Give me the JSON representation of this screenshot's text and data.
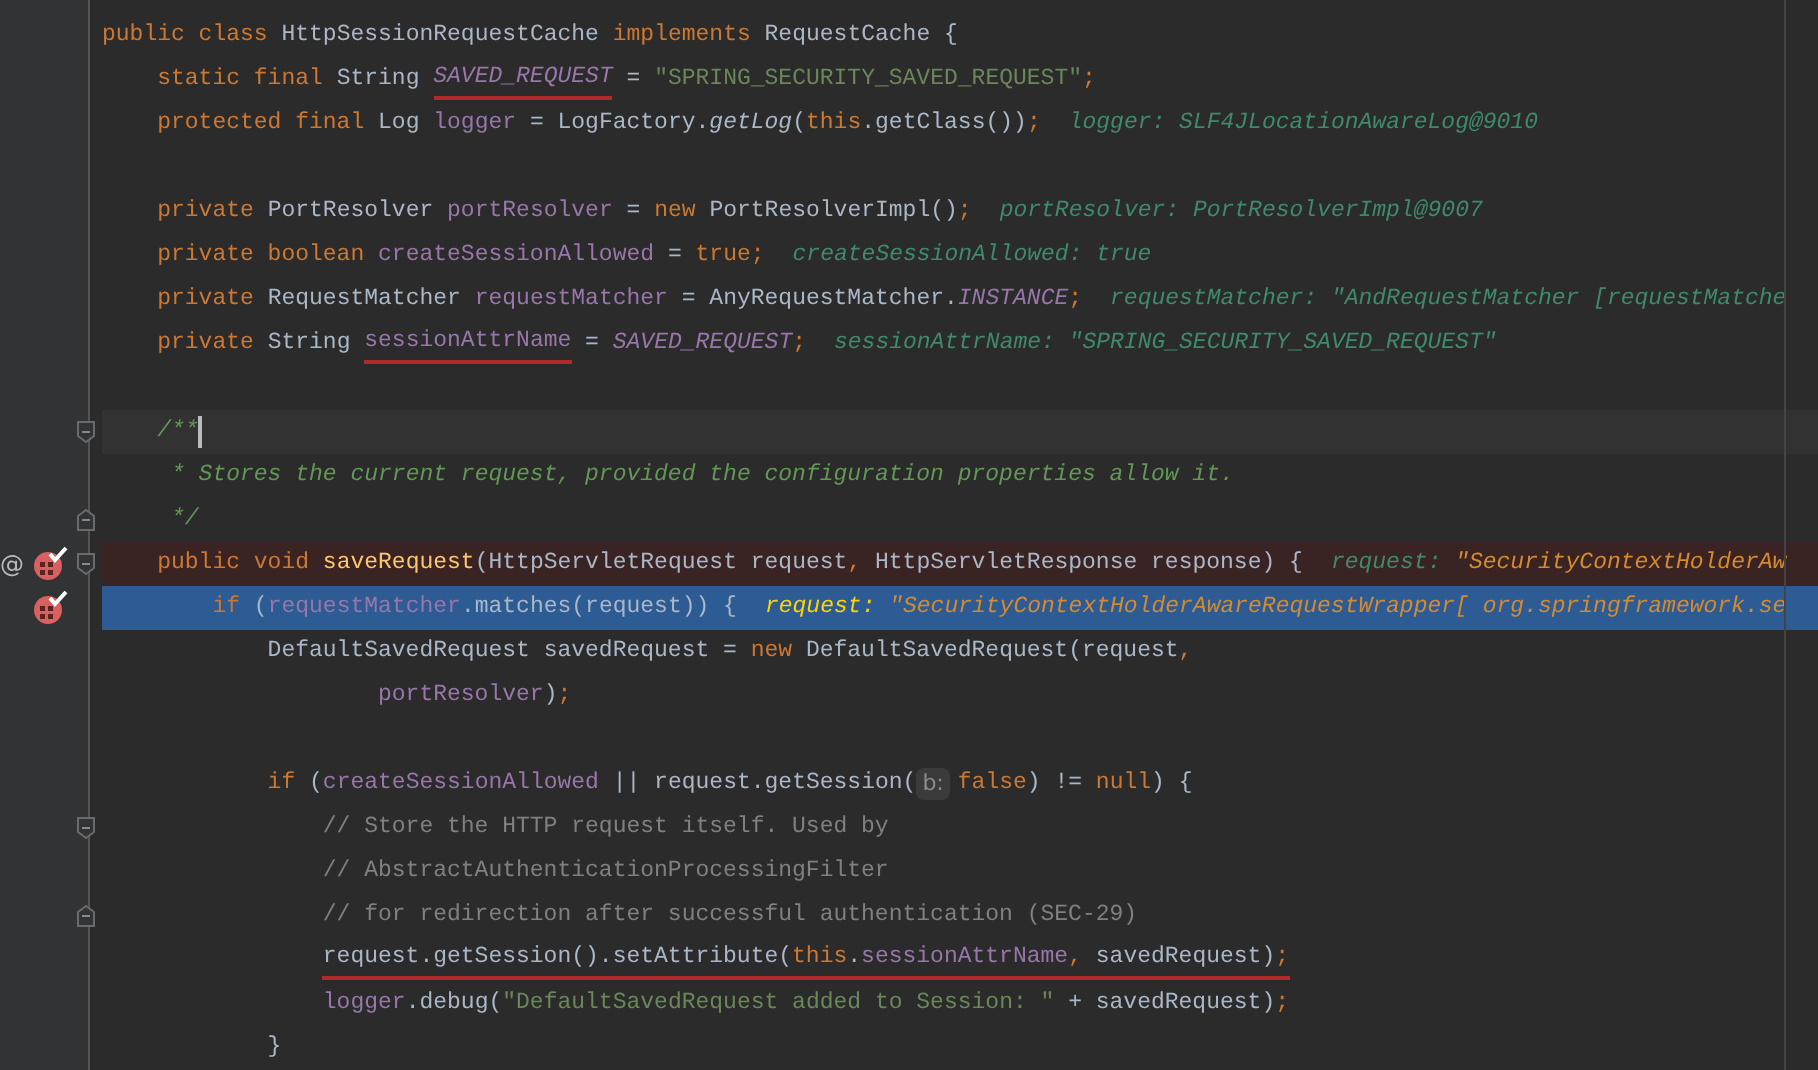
{
  "editor": {
    "lines": [
      {
        "breakpoint": false,
        "execution_point": false,
        "caret": false,
        "tokens": [
          {
            "text": "public class ",
            "kind": "keyword"
          },
          {
            "text": "HttpSessionRequestCache ",
            "kind": "plain"
          },
          {
            "text": "implements ",
            "kind": "keyword"
          },
          {
            "text": "RequestCache {",
            "kind": "plain"
          }
        ],
        "children": [
          {
            "breakpoint": false,
            "execution_point": false,
            "caret": false,
            "tokens": [
              {
                "text": "static final ",
                "kind": "keyword"
              },
              {
                "text": "String ",
                "kind": "plain"
              },
              {
                "text": "SAVED_REQUEST",
                "kind": "static",
                "underlined": true
              },
              {
                "text": " = ",
                "kind": "plain"
              },
              {
                "text": "\"SPRING_SECURITY_SAVED_REQUEST\"",
                "kind": "string"
              },
              {
                "text": ";",
                "kind": "punct"
              }
            ]
          },
          {
            "breakpoint": false,
            "execution_point": false,
            "caret": false,
            "tokens": [
              {
                "text": "protected final ",
                "kind": "keyword"
              },
              {
                "text": "Log ",
                "kind": "plain"
              },
              {
                "text": "logger",
                "kind": "field"
              },
              {
                "text": " = LogFactory.",
                "kind": "plain"
              },
              {
                "text": "getLog",
                "kind": "static_call"
              },
              {
                "text": "(",
                "kind": "plain"
              },
              {
                "text": "this",
                "kind": "keyword"
              },
              {
                "text": ".getClass())",
                "kind": "plain"
              },
              {
                "text": ";",
                "kind": "punct"
              },
              {
                "text": "logger: SLF4JLocationAwareLog@9010",
                "kind": "debug"
              }
            ]
          },
          {
            "breakpoint": false,
            "execution_point": false,
            "caret": false
          },
          {
            "breakpoint": false,
            "execution_point": false,
            "caret": false,
            "tokens": [
              {
                "text": "private ",
                "kind": "keyword"
              },
              {
                "text": "PortResolver ",
                "kind": "plain"
              },
              {
                "text": "portResolver",
                "kind": "field"
              },
              {
                "text": " = ",
                "kind": "plain"
              },
              {
                "text": "new ",
                "kind": "keyword"
              },
              {
                "text": "PortResolverImpl()",
                "kind": "plain"
              },
              {
                "text": ";",
                "kind": "punct"
              },
              {
                "text": "portResolver: PortResolverImpl@9007",
                "kind": "debug"
              }
            ]
          },
          {
            "breakpoint": false,
            "execution_point": false,
            "caret": false,
            "tokens": [
              {
                "text": "private boolean ",
                "kind": "keyword"
              },
              {
                "text": "createSessionAllowed",
                "kind": "field"
              },
              {
                "text": " = ",
                "kind": "plain"
              },
              {
                "text": "true",
                "kind": "keyword"
              },
              {
                "text": ";",
                "kind": "punct"
              },
              {
                "text": "createSessionAllowed: true",
                "kind": "debug"
              }
            ]
          },
          {
            "breakpoint": false,
            "execution_point": false,
            "caret": false,
            "tokens": [
              {
                "text": "private ",
                "kind": "keyword"
              },
              {
                "text": "RequestMatcher ",
                "kind": "plain"
              },
              {
                "text": "requestMatcher",
                "kind": "field"
              },
              {
                "text": " = AnyRequestMatcher.",
                "kind": "plain"
              },
              {
                "text": "INSTANCE",
                "kind": "static"
              },
              {
                "text": ";",
                "kind": "punct"
              },
              {
                "text": "requestMatcher: \"AndRequestMatcher [requestMatche",
                "kind": "debug"
              }
            ]
          },
          {
            "breakpoint": false,
            "execution_point": false,
            "caret": false,
            "tokens": [
              {
                "text": "private ",
                "kind": "keyword"
              },
              {
                "text": "String ",
                "kind": "plain"
              },
              {
                "text": "sessionAttrName",
                "kind": "field",
                "underlined": true
              },
              {
                "text": " = ",
                "kind": "plain"
              },
              {
                "text": "SAVED_REQUEST",
                "kind": "static"
              },
              {
                "text": ";",
                "kind": "punct"
              },
              {
                "text": "sessionAttrName: \"SPRING_SECURITY_SAVED_REQUEST\"",
                "kind": "debug"
              }
            ]
          },
          {
            "breakpoint": false,
            "execution_point": false,
            "caret": false
          },
          {
            "breakpoint": false,
            "execution_point": false,
            "caret": true,
            "fold_start": true,
            "tokens": [
              {
                "text": "/**",
                "kind": "doc"
              }
            ]
          },
          {
            "breakpoint": false,
            "execution_point": false,
            "caret": false,
            "tokens": [
              {
                "text": " * Stores the current request, provided the configuration properties allow it.",
                "kind": "doc"
              }
            ]
          },
          {
            "breakpoint": false,
            "execution_point": false,
            "caret": false,
            "fold_end": true,
            "tokens": [
              {
                "text": " */",
                "kind": "doc"
              }
            ]
          },
          {
            "breakpoint": true,
            "execution_point": false,
            "caret": false,
            "gutter_mark": "@",
            "fold_start": true,
            "tokens": [
              {
                "text": "public void ",
                "kind": "keyword"
              },
              {
                "text": "saveRequest",
                "kind": "method"
              },
              {
                "text": "(HttpServletRequest request",
                "kind": "plain"
              },
              {
                "text": ", ",
                "kind": "punct"
              },
              {
                "text": "HttpServletResponse response) {",
                "kind": "plain"
              },
              {
                "text": "request: ",
                "kind": "debug"
              },
              {
                "text": "\"SecurityContextHolderAw",
                "kind": "debug_value"
              }
            ],
            "children": [
              {
                "breakpoint": true,
                "execution_point": true,
                "caret": false,
                "tokens": [
                  {
                    "text": "if ",
                    "kind": "keyword"
                  },
                  {
                    "text": "(",
                    "kind": "plain"
                  },
                  {
                    "text": "requestMatcher",
                    "kind": "field"
                  },
                  {
                    "text": ".matches(request)) {",
                    "kind": "plain"
                  },
                  {
                    "text": "request: ",
                    "kind": "debug_label"
                  },
                  {
                    "text": "\"SecurityContextHolderAwareRequestWrapper[ org.springframework.se",
                    "kind": "debug_value"
                  }
                ],
                "children": [
                  {
                    "breakpoint": false,
                    "execution_point": false,
                    "caret": false,
                    "tokens": [
                      {
                        "text": "DefaultSavedRequest savedRequest = ",
                        "kind": "plain"
                      },
                      {
                        "text": "new ",
                        "kind": "keyword"
                      },
                      {
                        "text": "DefaultSavedRequest(request",
                        "kind": "plain"
                      },
                      {
                        "text": ",",
                        "kind": "punct"
                      }
                    ]
                  },
                  {
                    "breakpoint": false,
                    "execution_point": false,
                    "caret": false,
                    "continuation": true,
                    "tokens": [
                      {
                        "text": "portResolver",
                        "kind": "field"
                      },
                      {
                        "text": ")",
                        "kind": "plain"
                      },
                      {
                        "text": ";",
                        "kind": "punct"
                      }
                    ]
                  },
                  {
                    "breakpoint": false,
                    "execution_point": false,
                    "caret": false
                  },
                  {
                    "breakpoint": false,
                    "execution_point": false,
                    "caret": false,
                    "tokens": [
                      {
                        "text": "if ",
                        "kind": "keyword"
                      },
                      {
                        "text": "(",
                        "kind": "plain"
                      },
                      {
                        "text": "createSessionAllowed",
                        "kind": "field"
                      },
                      {
                        "text": " || request.getSession(",
                        "kind": "plain"
                      },
                      {
                        "text": "b:",
                        "kind": "param_hint"
                      },
                      {
                        "text": "false",
                        "kind": "keyword"
                      },
                      {
                        "text": ") != ",
                        "kind": "plain"
                      },
                      {
                        "text": "null",
                        "kind": "keyword"
                      },
                      {
                        "text": ") {",
                        "kind": "plain"
                      }
                    ],
                    "children": [
                      {
                        "breakpoint": false,
                        "execution_point": false,
                        "caret": false,
                        "fold_start": true,
                        "tokens": [
                          {
                            "text": "// Store the HTTP request itself. Used by",
                            "kind": "comment"
                          }
                        ]
                      },
                      {
                        "breakpoint": false,
                        "execution_point": false,
                        "caret": false,
                        "tokens": [
                          {
                            "text": "// AbstractAuthenticationProcessingFilter",
                            "kind": "comment"
                          }
                        ]
                      },
                      {
                        "breakpoint": false,
                        "execution_point": false,
                        "caret": false,
                        "fold_end": true,
                        "tokens": [
                          {
                            "text": "// for redirection after successful authentication (SEC-29)",
                            "kind": "comment"
                          }
                        ]
                      },
                      {
                        "breakpoint": false,
                        "execution_point": false,
                        "caret": false,
                        "tokens": [
                          {
                            "text": "request.getSession().setAttribute(",
                            "kind": "plain",
                            "underlined": true
                          },
                          {
                            "text": "this",
                            "kind": "keyword",
                            "underlined": true
                          },
                          {
                            "text": ".",
                            "kind": "plain",
                            "underlined": true
                          },
                          {
                            "text": "sessionAttrName",
                            "kind": "field",
                            "underlined": true
                          },
                          {
                            "text": ", ",
                            "kind": "punct",
                            "underlined": true
                          },
                          {
                            "text": "savedRequest)",
                            "kind": "plain",
                            "underlined": true
                          },
                          {
                            "text": ";",
                            "kind": "punct",
                            "underlined": true
                          }
                        ]
                      },
                      {
                        "breakpoint": false,
                        "execution_point": false,
                        "caret": false,
                        "tokens": [
                          {
                            "text": "logger",
                            "kind": "field"
                          },
                          {
                            "text": ".debug(",
                            "kind": "plain"
                          },
                          {
                            "text": "\"DefaultSavedRequest added to Session: \"",
                            "kind": "string"
                          },
                          {
                            "text": " + savedRequest)",
                            "kind": "plain"
                          },
                          {
                            "text": ";",
                            "kind": "punct"
                          }
                        ]
                      }
                    ]
                  },
                  {
                    "breakpoint": false,
                    "execution_point": false,
                    "caret": false,
                    "tokens": [
                      {
                        "text": "}",
                        "kind": "plain"
                      }
                    ]
                  }
                ]
              }
            ]
          }
        ]
      }
    ]
  }
}
